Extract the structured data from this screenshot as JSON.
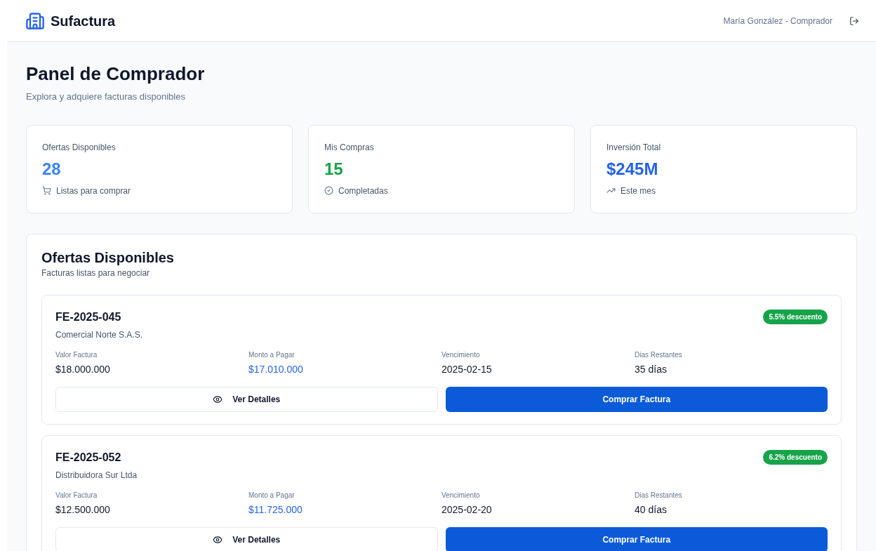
{
  "header": {
    "brand": "Sufactura",
    "user": "María González - Comprador"
  },
  "page": {
    "title": "Panel de Comprador",
    "subtitle": "Explora y adquiere facturas disponibles"
  },
  "stats": [
    {
      "label": "Ofertas Disponibles",
      "value": "28",
      "color": "#3b82f6",
      "kind": "cart",
      "note": "Listas para comprar"
    },
    {
      "label": "Mis Compras",
      "value": "15",
      "color": "#16a34a",
      "kind": "check",
      "note": "Completadas"
    },
    {
      "label": "Inversión Total",
      "value": "$245M",
      "color": "#2563eb",
      "kind": "trend",
      "note": "Este mes"
    }
  ],
  "offers": {
    "title": "Ofertas Disponibles",
    "subtitle": "Facturas listas para negociar",
    "items": [
      {
        "id": "FE-2025-045",
        "company": "Comercial Norte S.A.S.",
        "badge": "5.5% descuento",
        "fields": [
          {
            "label": "Valor Factura",
            "value": "$18.000.000",
            "highlighted": false
          },
          {
            "label": "Monto a Pagar",
            "value": "$17.010.000",
            "highlighted": true
          },
          {
            "label": "Vencimiento",
            "value": "2025-02-15",
            "highlighted": false
          },
          {
            "label": "Dias Restantes",
            "value": "35 días",
            "highlighted": false
          }
        ],
        "details_button": "Ver Detalles",
        "buy_button": "Comprar Factura"
      },
      {
        "id": "FE-2025-052",
        "company": "Distribuidora Sur Ltda",
        "badge": "6.2% descuento",
        "fields": [
          {
            "label": "Valor Factura",
            "value": "$12.500.000",
            "highlighted": false
          },
          {
            "label": "Monto a Pagar",
            "value": "$11.725.000",
            "highlighted": true
          },
          {
            "label": "Vencimiento",
            "value": "2025-02-20",
            "highlighted": false
          },
          {
            "label": "Dias Restantes",
            "value": "40 días",
            "highlighted": false
          }
        ],
        "details_button": "Ver Detalles",
        "buy_button": "Comprar Factura"
      }
    ]
  }
}
